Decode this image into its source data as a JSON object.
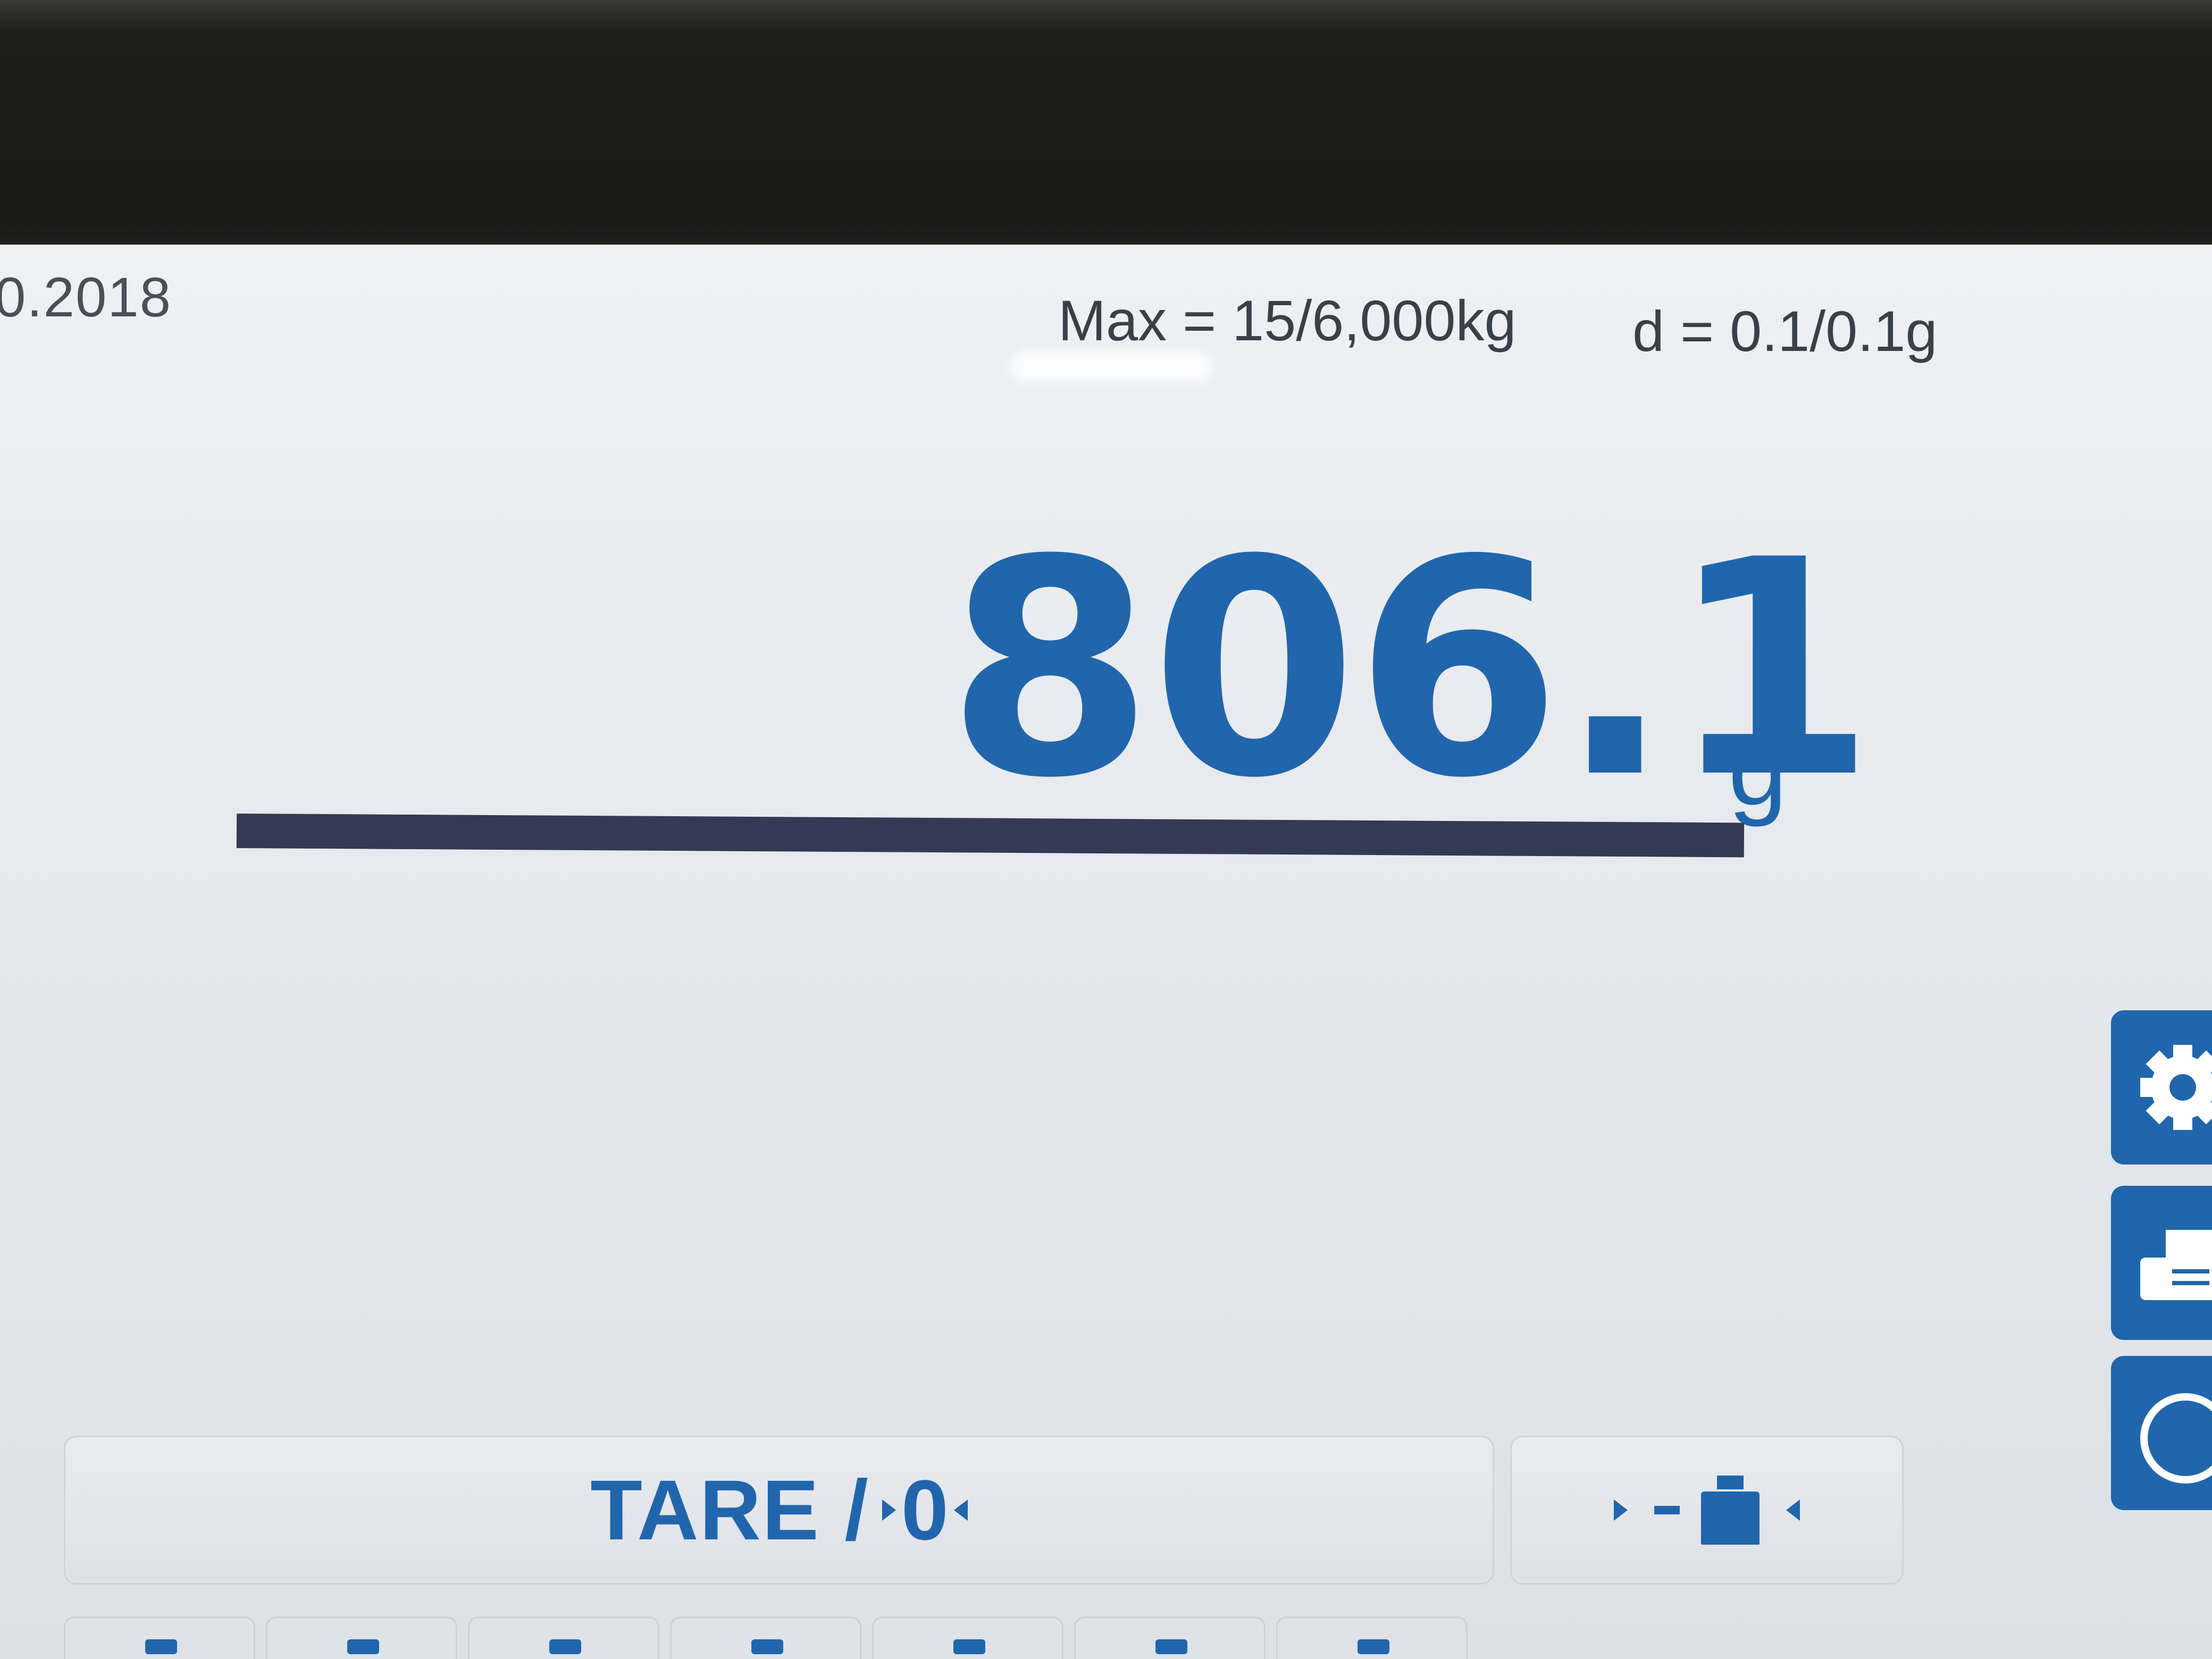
{
  "header": {
    "date_fragment": "0.2018",
    "max_capacity": "Max = 15/6,000kg",
    "readability": "d = 0.1/0.1g"
  },
  "display": {
    "weight_value": "806.1",
    "unit": "g"
  },
  "softkeys": {
    "tare_label": "TARE /",
    "tare_zero_label": "0"
  },
  "icons": {
    "settings": "gear-icon",
    "print": "print-icon",
    "info": "info-icon",
    "adjust": "calibration-weight-icon"
  },
  "colors": {
    "accent": "#2166ad",
    "bar": "#343a54",
    "screen_bg": "#e8ebef"
  }
}
